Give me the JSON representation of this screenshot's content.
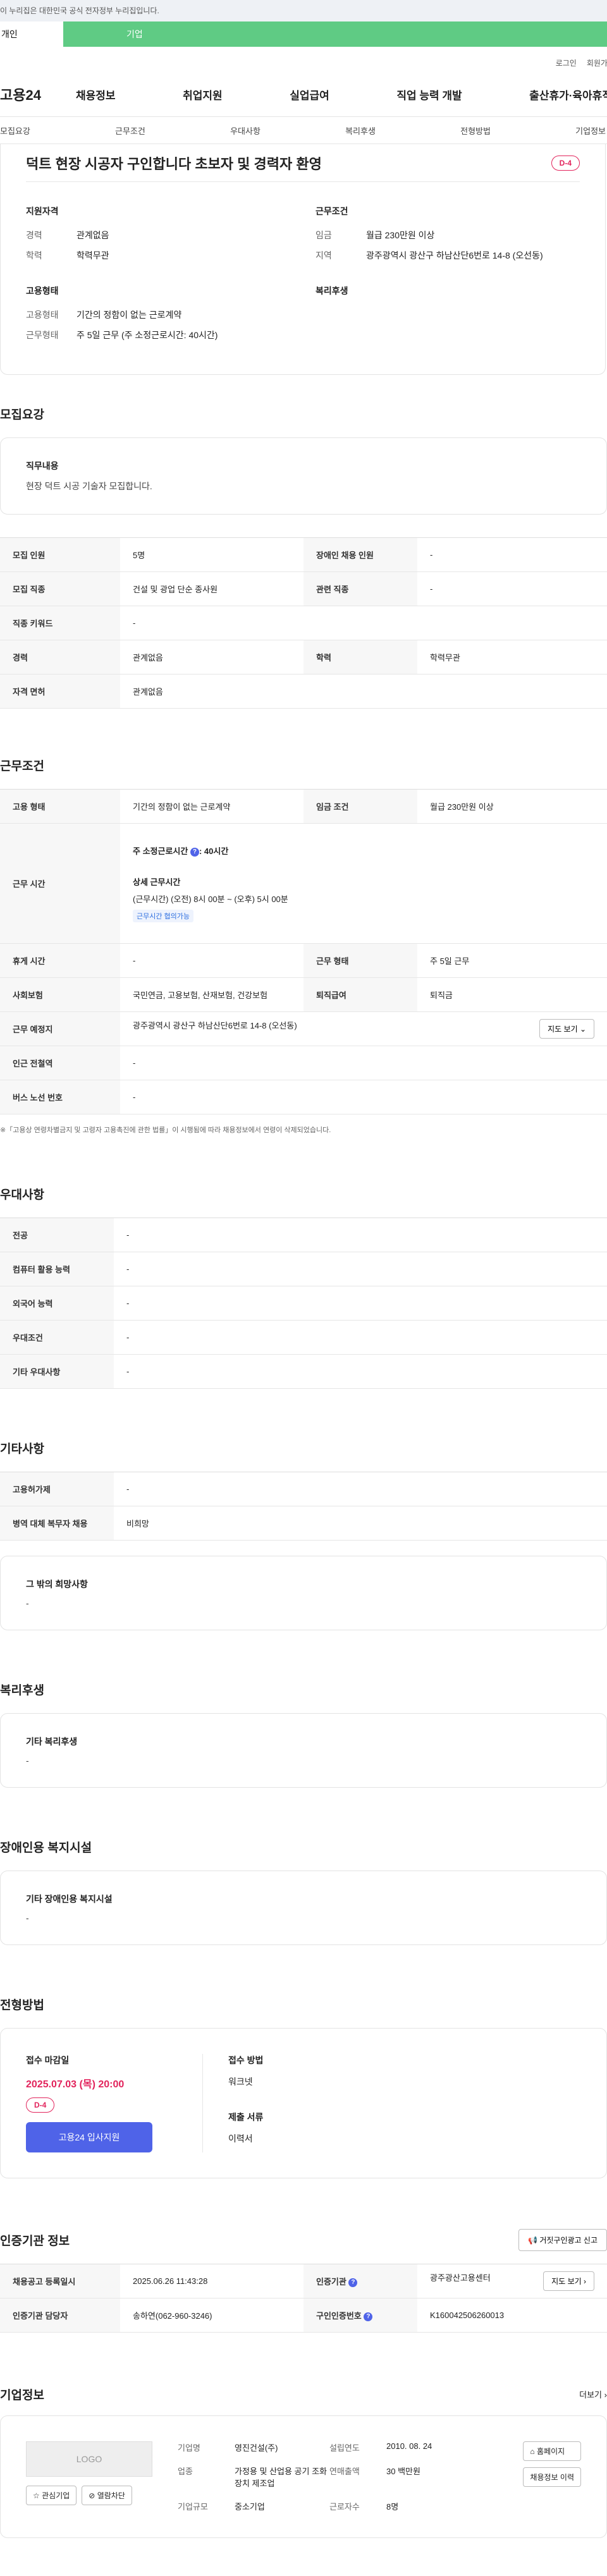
{
  "gov_banner": "이 누리집은 대한민국 공식 전자정부 누리집입니다.",
  "top_tabs": [
    "개인",
    "기업"
  ],
  "util": [
    "로그인",
    "회원가입"
  ],
  "gnb": {
    "logo": "고용24",
    "menu": [
      "채용정보",
      "취업지원",
      "실업급여",
      "직업 능력 개발",
      "출산휴가·육아휴직"
    ]
  },
  "anchors": [
    "모집요강",
    "근무조건",
    "우대사항",
    "복리후생",
    "전형방법",
    "기업정보"
  ],
  "title": "덕트 현장 시공자 구인합니다 초보자 및 경력자 환영",
  "dday": "D-4",
  "summary": {
    "qual": {
      "title": "지원자격",
      "rows": [
        {
          "k": "경력",
          "v": "관계없음"
        },
        {
          "k": "학력",
          "v": "학력무관"
        }
      ]
    },
    "cond": {
      "title": "근무조건",
      "rows": [
        {
          "k": "임금",
          "v": "월급 230만원 이상"
        },
        {
          "k": "지역",
          "v": "광주광역시 광산구 하남산단6번로 14-8 (오선동)"
        }
      ]
    },
    "emp": {
      "title": "고용형태",
      "rows": [
        {
          "k": "고용형태",
          "v": "기간의 정함이 없는 근로계약"
        },
        {
          "k": "근무형태",
          "v": "주 5일 근무 (주 소정근로시간: 40시간)"
        }
      ]
    },
    "welfare": {
      "title": "복리후생"
    }
  },
  "recruit": {
    "title": "모집요강",
    "duty_title": "직무내용",
    "duty": "현장 덕트 시공 기술자 모집합니다.",
    "table": [
      [
        "모집 인원",
        "5명",
        "장애인 채용 인원",
        "-"
      ],
      [
        "모집 직종",
        "건설 및 광업 단순 종사원",
        "관련 직종",
        "-"
      ],
      [
        "직종 키워드",
        "-"
      ],
      [
        "경력",
        "관계없음",
        "학력",
        "학력무관"
      ],
      [
        "자격 면허",
        "관계없음"
      ]
    ]
  },
  "work": {
    "title": "근무조건",
    "emp_type": {
      "k": "고용 형태",
      "v": "기간의 정함이 없는 근로계약",
      "k2": "임금 조건",
      "v2": "월급 230만원 이상"
    },
    "hours": {
      "k": "근무 시간",
      "line1": "주 소정근로시간",
      "q": "?",
      "line1b": ": 40시간",
      "line2": "상세 근무시간",
      "line3": "(근무시간) (오전) 8시 00분 ~ (오후) 5시 00분",
      "tag": "근무시간 협의가능"
    },
    "rest": [
      [
        "휴게 시간",
        "-",
        "근무 형태",
        "주 5일 근무"
      ],
      [
        "사회보험",
        "국민연금, 고용보험, 산재보험, 건강보험",
        "퇴직급여",
        "퇴직금"
      ]
    ],
    "place": {
      "k": "근무 예정지",
      "v": "광주광역시 광산구 하남산단6번로 14-8 (오선동)",
      "btn": "지도 보기"
    },
    "more": [
      [
        "인근 전철역",
        "-"
      ],
      [
        "버스 노선 번호",
        "-"
      ]
    ],
    "note": "※「고용상 연령차별금지 및 고령자 고용촉진에 관한 법률」이 시행됨에 따라 채용정보에서 연령이 삭제되었습니다."
  },
  "pref": {
    "title": "우대사항",
    "rows": [
      [
        "전공",
        "-"
      ],
      [
        "컴퓨터 활용 능력",
        "-"
      ],
      [
        "외국어 능력",
        "-"
      ],
      [
        "우대조건",
        "-"
      ],
      [
        "기타 우대사항",
        "-"
      ]
    ]
  },
  "etc": {
    "title": "기타사항",
    "rows": [
      [
        "고용허가제",
        "-"
      ],
      [
        "병역 대체 복무자 채용",
        "비희망"
      ]
    ],
    "box_title": "그 밖의 희망사항",
    "box_v": "-"
  },
  "welfare": {
    "title": "복리후생",
    "box_title": "기타 복리후생",
    "box_v": "-"
  },
  "disab": {
    "title": "장애인용 복지시설",
    "box_title": "기타 장애인용 복지시설",
    "box_v": "-"
  },
  "apply": {
    "title": "전형방법",
    "deadline_title": "접수 마감일",
    "deadline": "2025.07.03 (목) 20:00",
    "dday": "D-4",
    "btn": "고용24 입사지원",
    "method_title": "접수 방법",
    "method": "워크넷",
    "docs_title": "제출 서류",
    "docs": "이력서"
  },
  "agency": {
    "title": "인증기관 정보",
    "report": "거짓구인광고 신고",
    "reg_k": "채용공고 등록일시",
    "reg_v": "2025.06.26 11:43:28",
    "org_k": "인증기관",
    "org_v": "광주광산고용센터",
    "map_btn": "지도 보기",
    "mgr_k": "인증기관 담당자",
    "mgr_v": "송하연(062-960-3246)",
    "no_k": "구인인증번호",
    "no_v": "K160042506260013"
  },
  "company": {
    "title": "기업정보",
    "more": "더보기",
    "logo": "LOGO",
    "like": "관심기업",
    "block": "열람차단",
    "rows": {
      "name_k": "기업명",
      "name_v": "영진건설(주)",
      "ind_k": "업종",
      "ind_v": "가정용 및 산업용 공기 조화장치 제조업",
      "size_k": "기업규모",
      "size_v": "중소기업",
      "est_k": "설립연도",
      "est_v": "2010. 08. 24",
      "sales_k": "연매출액",
      "sales_v": "30 백만원",
      "emp_k": "근로자수",
      "emp_v": "8명"
    },
    "home": "홈페이지",
    "history": "채용정보 이력"
  }
}
